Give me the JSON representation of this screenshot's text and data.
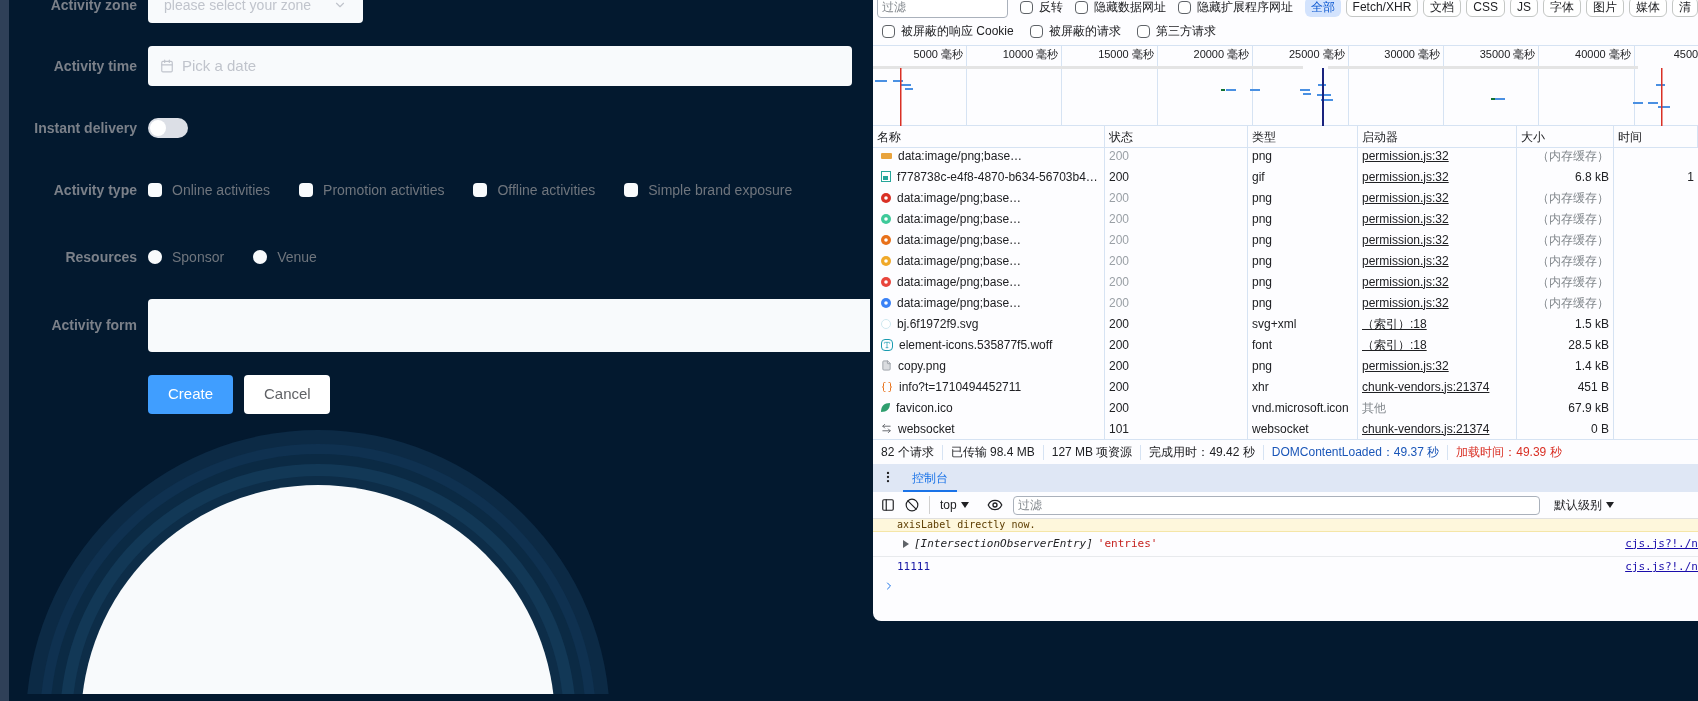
{
  "form": {
    "fields": [
      {
        "kind": "select",
        "label": "Activity zone",
        "placeholder": "please select your zone"
      },
      {
        "kind": "date",
        "label": "Activity time",
        "placeholder": "Pick a date"
      },
      {
        "kind": "switch",
        "label": "Instant delivery",
        "on": false
      },
      {
        "kind": "checkboxes",
        "label": "Activity type",
        "options": [
          {
            "label": "Online activities",
            "checked": false
          },
          {
            "label": "Promotion activities",
            "checked": false
          },
          {
            "label": "Offline activities",
            "checked": false
          },
          {
            "label": "Simple brand exposure",
            "checked": false
          }
        ]
      },
      {
        "kind": "radios",
        "label": "Resources",
        "options": [
          {
            "label": "Sponsor",
            "selected": false
          },
          {
            "label": "Venue",
            "selected": false
          }
        ]
      },
      {
        "kind": "textarea",
        "label": "Activity form"
      }
    ],
    "buttons": [
      {
        "label": "Create",
        "kind": "primary"
      },
      {
        "label": "Cancel",
        "kind": "default"
      }
    ]
  },
  "devtools": {
    "filter": {
      "placeholder": "过滤"
    },
    "toggles": [
      {
        "label": "反转",
        "checked": false
      },
      {
        "label": "隐藏数据网址",
        "checked": false
      },
      {
        "label": "隐藏扩展程序网址",
        "checked": false
      }
    ],
    "type_filters": [
      {
        "label": "全部",
        "selected": true
      },
      {
        "label": "Fetch/XHR",
        "selected": false
      },
      {
        "label": "文档",
        "selected": false
      },
      {
        "label": "CSS",
        "selected": false
      },
      {
        "label": "JS",
        "selected": false
      },
      {
        "label": "字体",
        "selected": false
      },
      {
        "label": "图片",
        "selected": false
      },
      {
        "label": "媒体",
        "selected": false
      },
      {
        "label": "清",
        "selected": false
      }
    ],
    "toggles_2": [
      {
        "label": "被屏蔽的响应 Cookie",
        "checked": false
      },
      {
        "label": "被屏蔽的请求",
        "checked": false
      },
      {
        "label": "第三方请求",
        "checked": false
      }
    ],
    "timeline_ticks": [
      "5000 毫秒",
      "10000 毫秒",
      "15000 毫秒",
      "20000 毫秒",
      "25000 毫秒",
      "30000 毫秒",
      "35000 毫秒",
      "40000 毫秒",
      "4500"
    ],
    "table": {
      "columns": [
        "名称",
        "状态",
        "类型",
        "启动器",
        "大小",
        "时间"
      ],
      "rows": [
        {
          "kind": "thumb",
          "color": "#e8a33d",
          "name": "data:image/png;base…",
          "status": "200",
          "type": "png",
          "initiator": "permission.js:32",
          "initiator_link": true,
          "size": "（内存缓存）",
          "cached": true
        },
        {
          "kind": "animated",
          "color": "#26a69a",
          "name": "f778738c-e4f8-4870-b634-56703b4…",
          "status": "200",
          "type": "gif",
          "initiator": "permission.js:32",
          "initiator_link": true,
          "size": "6.8 kB",
          "cached": false,
          "time": "1"
        },
        {
          "kind": "image",
          "color": "#d93025",
          "name": "data:image/png;base…",
          "status": "200",
          "type": "png",
          "initiator": "permission.js:32",
          "initiator_link": true,
          "size": "（内存缓存）",
          "cached": true
        },
        {
          "kind": "image",
          "color": "#3ec99a",
          "name": "data:image/png;base…",
          "status": "200",
          "type": "png",
          "initiator": "permission.js:32",
          "initiator_link": true,
          "size": "（内存缓存）",
          "cached": true
        },
        {
          "kind": "image",
          "color": "#e8711a",
          "name": "data:image/png;base…",
          "status": "200",
          "type": "png",
          "initiator": "permission.js:32",
          "initiator_link": true,
          "size": "（内存缓存）",
          "cached": true
        },
        {
          "kind": "image",
          "color": "#f0a92a",
          "name": "data:image/png;base…",
          "status": "200",
          "type": "png",
          "initiator": "permission.js:32",
          "initiator_link": true,
          "size": "（内存缓存）",
          "cached": true
        },
        {
          "kind": "image",
          "color": "#e8453c",
          "name": "data:image/png;base…",
          "status": "200",
          "type": "png",
          "initiator": "permission.js:32",
          "initiator_link": true,
          "size": "（内存缓存）",
          "cached": true
        },
        {
          "kind": "image",
          "color": "#3b82f6",
          "name": "data:image/png;base…",
          "status": "200",
          "type": "png",
          "initiator": "permission.js:32",
          "initiator_link": true,
          "size": "（内存缓存）",
          "cached": true
        },
        {
          "kind": "vector",
          "name": "bj.6f1972f9.svg",
          "status": "200",
          "type": "svg+xml",
          "initiator": "（索引）:18",
          "initiator_link": true,
          "size": "1.5 kB",
          "cached": false
        },
        {
          "kind": "typeface",
          "color": "#1a9bb0",
          "name": "element-icons.535877f5.woff",
          "status": "200",
          "type": "font",
          "initiator": "（索引）:18",
          "initiator_link": true,
          "size": "28.5 kB",
          "cached": false
        },
        {
          "kind": "document",
          "name": "copy.png",
          "status": "200",
          "type": "png",
          "initiator": "permission.js:32",
          "initiator_link": true,
          "size": "1.4 kB",
          "cached": false
        },
        {
          "kind": "request",
          "color": "#e8711a",
          "name": "info?t=1710494452711",
          "status": "200",
          "type": "xhr",
          "initiator": "chunk-vendors.js:21374",
          "initiator_link": true,
          "size": "451 B",
          "cached": false
        },
        {
          "kind": "leaf",
          "color": "#2e9e6e",
          "name": "favicon.ico",
          "status": "200",
          "type": "vnd.microsoft.icon",
          "initiator": "其他",
          "initiator_link": false,
          "size": "67.9 kB",
          "cached": false
        },
        {
          "kind": "socket",
          "name": "websocket",
          "status": "101",
          "type": "websocket",
          "initiator": "chunk-vendors.js:21374",
          "initiator_link": true,
          "size": "0 B",
          "cached": false
        }
      ]
    },
    "summary": [
      {
        "text": "82 个请求",
        "kind": "plain"
      },
      {
        "text": "已传输 98.4 MB",
        "kind": "plain"
      },
      {
        "text": "127 MB 项资源",
        "kind": "plain"
      },
      {
        "text": "完成用时：49.42 秒",
        "kind": "plain"
      },
      {
        "text": "DOMContentLoaded：49.37 秒",
        "kind": "dom"
      },
      {
        "text": "加载时间：49.39 秒",
        "kind": "load"
      }
    ],
    "drawer": {
      "tabs": [
        {
          "label": "控制台",
          "selected": true
        }
      ],
      "context": "top",
      "filter": {
        "placeholder": "过滤"
      },
      "level": "默认级别",
      "messages": [
        {
          "kind": "warning",
          "text": "axisLabel directly now."
        },
        {
          "kind": "object",
          "label": "[IntersectionObserverEntry]",
          "value": "'entries'",
          "source": "cjs.js?!./n"
        },
        {
          "kind": "log",
          "text": "11111",
          "source": "cjs.js?!./n"
        }
      ]
    }
  }
}
